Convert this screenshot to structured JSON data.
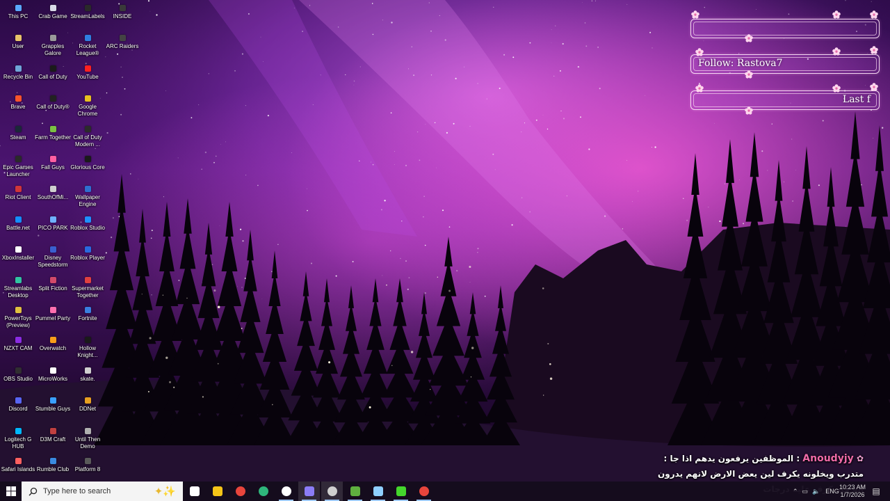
{
  "desktop_icons": [
    {
      "label": "This PC",
      "color": "#5aa8ff"
    },
    {
      "label": "Crab Game",
      "color": "#d9d9e8"
    },
    {
      "label": "StreamLabels",
      "color": "#2a2a2a"
    },
    {
      "label": "INSIDE",
      "color": "#3a3a3a"
    },
    {
      "label": "User",
      "color": "#e8c46a"
    },
    {
      "label": "Grapples Galore",
      "color": "#9a9a9a"
    },
    {
      "label": "Rocket League®",
      "color": "#2f7fe0"
    },
    {
      "label": "ARC Raiders",
      "color": "#444444"
    },
    {
      "label": "Recycle Bin",
      "color": "#6fa6d8"
    },
    {
      "label": "Call of Duty",
      "color": "#1b1b1b"
    },
    {
      "label": "YouTube",
      "color": "#ff2020"
    },
    {
      "label": "Brave",
      "color": "#fb542b"
    },
    {
      "label": "Call of Duty®",
      "color": "#222222"
    },
    {
      "label": "Google Chrome",
      "color": "#e8c020"
    },
    {
      "label": "Steam",
      "color": "#1b2838"
    },
    {
      "label": "Farm Together",
      "color": "#7bc043"
    },
    {
      "label": "Call of Duty Modern ...",
      "color": "#2b2b2b"
    },
    {
      "label": "Epic Games Launcher",
      "color": "#2a2a2a"
    },
    {
      "label": "Fall Guys",
      "color": "#ff5fa2"
    },
    {
      "label": "Glorious Core",
      "color": "#1a1a1a"
    },
    {
      "label": "Riot Client",
      "color": "#d13639"
    },
    {
      "label": "SouthOfMi...",
      "color": "#cfcfcf"
    },
    {
      "label": "Wallpaper Engine",
      "color": "#2f6fd0"
    },
    {
      "label": "Battle.net",
      "color": "#148eff"
    },
    {
      "label": "PICO PARK",
      "color": "#6fb0ff"
    },
    {
      "label": "Roblox Studio",
      "color": "#1e90ff"
    },
    {
      "label": "XboxInstaller",
      "color": "#ffffff"
    },
    {
      "label": "Disney Speedstorm",
      "color": "#3a5fd0"
    },
    {
      "label": "Roblox Player",
      "color": "#2a6ae0"
    },
    {
      "label": "Streamlabs Desktop",
      "color": "#31c3a2"
    },
    {
      "label": "Split Fiction",
      "color": "#d24a6a"
    },
    {
      "label": "Supermarket Together",
      "color": "#e04040"
    },
    {
      "label": "PowerToys (Preview)",
      "color": "#e0c040"
    },
    {
      "label": "Pummel Party",
      "color": "#ff6fb0"
    },
    {
      "label": "Fortnite",
      "color": "#3a7fe0"
    },
    {
      "label": "NZXT CAM",
      "color": "#8a2be2"
    },
    {
      "label": "Overwatch",
      "color": "#f99e1a"
    },
    {
      "label": "Hollow Knight...",
      "color": "#1a1a1a"
    },
    {
      "label": "OBS Studio",
      "color": "#302e31"
    },
    {
      "label": "MicroWorks",
      "color": "#ffffff"
    },
    {
      "label": "skate.",
      "color": "#d0d0d0"
    },
    {
      "label": "Discord",
      "color": "#5865f2"
    },
    {
      "label": "Stumble Guys",
      "color": "#3aa0ff"
    },
    {
      "label": "DDNet",
      "color": "#e8a020"
    },
    {
      "label": "Logitech G HUB",
      "color": "#00b8fc"
    },
    {
      "label": "D3M Craft",
      "color": "#c04040"
    },
    {
      "label": "Until Then Demo",
      "color": "#b0b0b0"
    },
    {
      "label": "Safari Islands",
      "color": "#ff6060"
    },
    {
      "label": "Rumble Club",
      "color": "#3a8ae0"
    },
    {
      "label": "Platform 8",
      "color": "#5a5a5a"
    }
  ],
  "overlay": {
    "panel1_text": "",
    "panel2_text": "Follow: Rastova7",
    "panel3_text": "Last f"
  },
  "chat": {
    "user": "Anoudyjy",
    "message": "الموظفين يرفعون يدهم اذا جا : متدرب ويخلونه يكرف لين يعض الارض لانهم يدرون انه فيه كرف عليه درجات"
  },
  "taskbar": {
    "search_placeholder": "Type here to search",
    "apps": [
      {
        "name": "task-view",
        "color": "#ffffff"
      },
      {
        "name": "file-explorer",
        "color": "#f5c518"
      },
      {
        "name": "chrome",
        "color": "#e8453c"
      },
      {
        "name": "edge",
        "color": "#2fb67c"
      },
      {
        "name": "steam",
        "color": "#ffffff"
      },
      {
        "name": "discord",
        "color": "#8b7cf6"
      },
      {
        "name": "obs",
        "color": "#cfcfcf"
      },
      {
        "name": "minecraft",
        "color": "#5faf3f"
      },
      {
        "name": "cube-app",
        "color": "#8fd0ff"
      },
      {
        "name": "razer",
        "color": "#44d62c"
      },
      {
        "name": "chrome-profile",
        "color": "#e8453c"
      }
    ],
    "tray_language": "ENG",
    "time": "10:23 AM",
    "date": "1/7/2026"
  }
}
